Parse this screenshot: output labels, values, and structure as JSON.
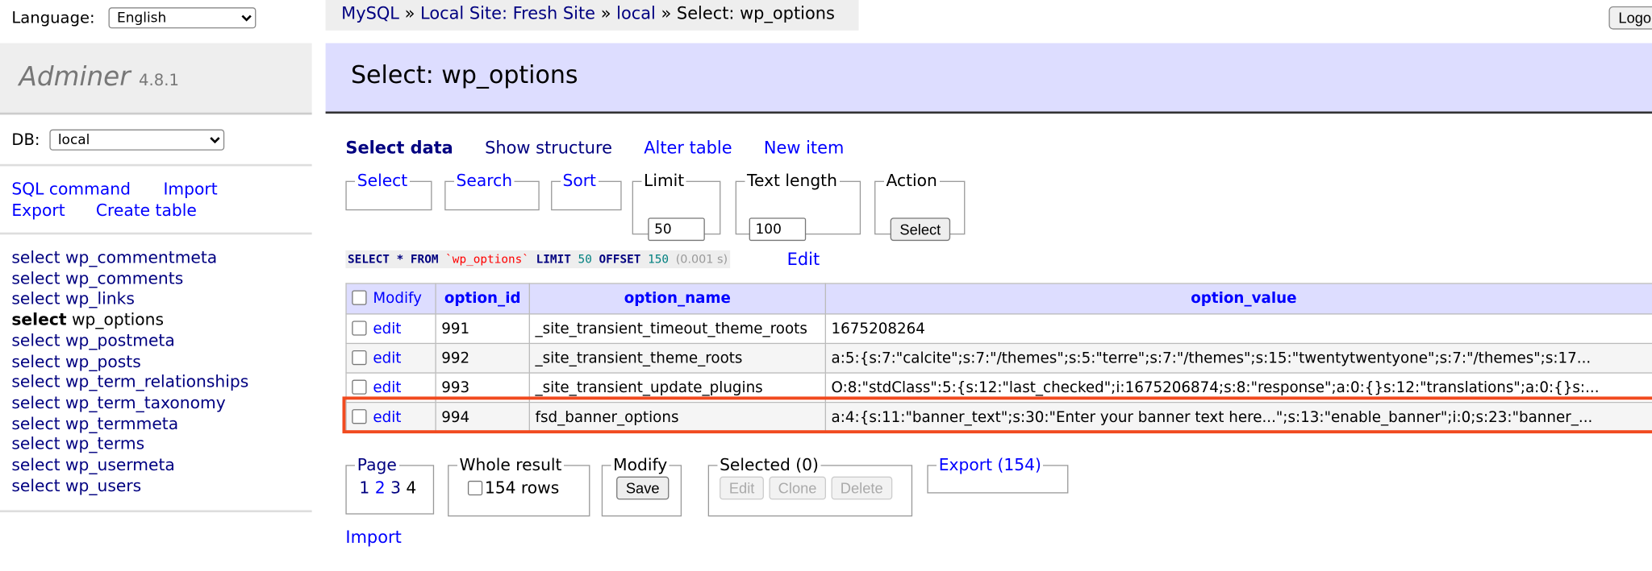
{
  "sidebar": {
    "language_label": "Language:",
    "language_value": "English",
    "logo": "Adminer",
    "version": "4.8.1",
    "db_label": "DB:",
    "db_value": "local",
    "links": [
      "SQL command",
      "Import",
      "Export",
      "Create table"
    ],
    "tables": [
      {
        "prefix": "select",
        "name": "wp_commentmeta",
        "active": false
      },
      {
        "prefix": "select",
        "name": "wp_comments",
        "active": false
      },
      {
        "prefix": "select",
        "name": "wp_links",
        "active": false
      },
      {
        "prefix": "select",
        "name": "wp_options",
        "active": true
      },
      {
        "prefix": "select",
        "name": "wp_postmeta",
        "active": false
      },
      {
        "prefix": "select",
        "name": "wp_posts",
        "active": false
      },
      {
        "prefix": "select",
        "name": "wp_term_relationships",
        "active": false
      },
      {
        "prefix": "select",
        "name": "wp_term_taxonomy",
        "active": false
      },
      {
        "prefix": "select",
        "name": "wp_termmeta",
        "active": false
      },
      {
        "prefix": "select",
        "name": "wp_terms",
        "active": false
      },
      {
        "prefix": "select",
        "name": "wp_usermeta",
        "active": false
      },
      {
        "prefix": "select",
        "name": "wp_users",
        "active": false
      }
    ]
  },
  "breadcrumb": {
    "items": [
      "MySQL",
      "Local Site: Fresh Site",
      "local"
    ],
    "current": "Select: wp_options",
    "sep": "»"
  },
  "logout_label": "Logout",
  "page_title": "Select: wp_options",
  "tabs": {
    "active": "Select data",
    "links": [
      "Show structure",
      "Alter table",
      "New item"
    ]
  },
  "filters": {
    "select": "Select",
    "search": "Search",
    "sort": "Sort",
    "limit_label": "Limit",
    "limit_value": "50",
    "text_length_label": "Text length",
    "text_length_value": "100",
    "action_label": "Action",
    "action_button": "Select"
  },
  "sql": {
    "select": "SELECT",
    "star": "*",
    "from": "FROM",
    "table": "`wp_options`",
    "limit": "LIMIT",
    "limit_n": "50",
    "offset": "OFFSET",
    "offset_n": "150",
    "time": "(0.001 s)",
    "edit": "Edit"
  },
  "table": {
    "headers": [
      "Modify",
      "option_id",
      "option_name",
      "option_value"
    ],
    "edit_label": "edit",
    "rows": [
      {
        "id": "991",
        "name": "_site_transient_timeout_theme_roots",
        "value": "1675208264"
      },
      {
        "id": "992",
        "name": "_site_transient_theme_roots",
        "value": "a:5:{s:7:\"calcite\";s:7:\"/themes\";s:5:\"terre\";s:7:\"/themes\";s:15:\"twentytwentyone\";s:7:\"/themes\";s:17..."
      },
      {
        "id": "993",
        "name": "_site_transient_update_plugins",
        "value": "O:8:\"stdClass\":5:{s:12:\"last_checked\";i:1675206874;s:8:\"response\";a:0:{}s:12:\"translations\";a:0:{}s:..."
      },
      {
        "id": "994",
        "name": "fsd_banner_options",
        "value": "a:4:{s:11:\"banner_text\";s:30:\"Enter your banner text here...\";s:13:\"enable_banner\";i:0;s:23:\"banner_..."
      }
    ],
    "highlight_color": "#f14a1f"
  },
  "footer": {
    "page_label": "Page",
    "pages": [
      "1",
      "2",
      "3",
      "4"
    ],
    "current_page": "4",
    "whole_label": "Whole result",
    "rows_label": "154 rows",
    "modify_label": "Modify",
    "save": "Save",
    "selected_label": "Selected (0)",
    "edit": "Edit",
    "clone": "Clone",
    "delete": "Delete",
    "export_label": "Export (154)",
    "import": "Import"
  }
}
